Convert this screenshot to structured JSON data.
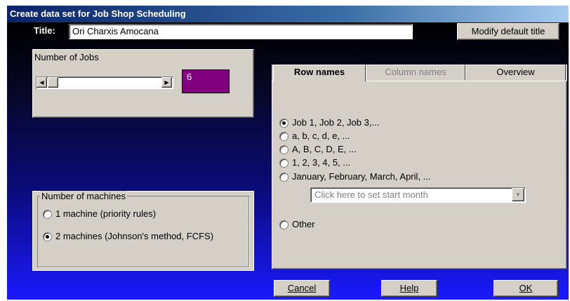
{
  "window": {
    "title": "Create data set for Job Shop Scheduling"
  },
  "title_row": {
    "label": "Title:",
    "value": "Ori Charxis Amocana",
    "modify_button": "Modify default title"
  },
  "jobs": {
    "label": "Number of Jobs",
    "value": "6",
    "color": "#800080"
  },
  "machines": {
    "label": "Number of machines",
    "options": [
      "1 machine (priority rules)",
      "2 machines (Johnson's method, FCFS)"
    ],
    "selected": 1
  },
  "tabs": [
    {
      "label": "Row names",
      "active": true
    },
    {
      "label": "Column names",
      "active": false,
      "disabled": true
    },
    {
      "label": "Overview",
      "active": false
    }
  ],
  "row_names": {
    "options": [
      "Job 1, Job 2, Job 3,...",
      "a, b, c, d, e, ...",
      "A, B, C, D, E, ...",
      "1, 2, 3, 4, 5, ...",
      "January, February, March, April, ..."
    ],
    "selected": 0,
    "month_dropdown": "Click here to set start month",
    "other_label": "Other"
  },
  "buttons": {
    "cancel": "Cancel",
    "help": "Help",
    "ok": "OK"
  }
}
